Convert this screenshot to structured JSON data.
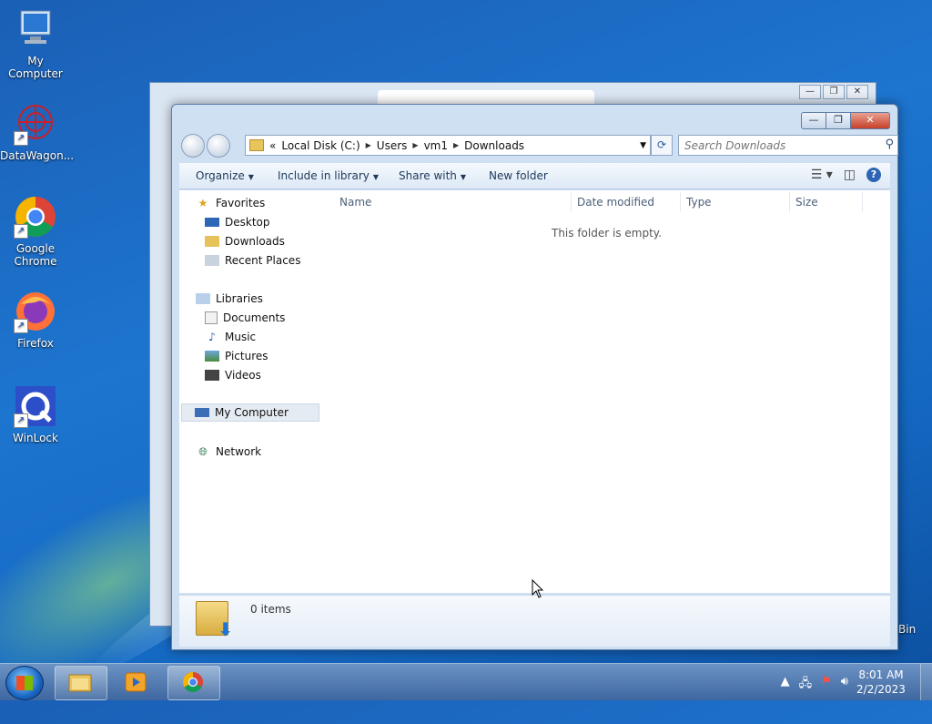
{
  "desktop": {
    "icons": [
      {
        "label": "My Computer"
      },
      {
        "label": "DataWagon..."
      },
      {
        "label": "Google Chrome"
      },
      {
        "label": "Firefox"
      },
      {
        "label": "WinLock"
      }
    ],
    "bin_label": "Bin"
  },
  "explorer": {
    "address": [
      "Local Disk (C:)",
      "Users",
      "vm1",
      "Downloads"
    ],
    "address_prefix": "«",
    "search_placeholder": "Search Downloads",
    "toolbar": {
      "organize": "Organize",
      "include": "Include in library",
      "share": "Share with",
      "new_folder": "New folder"
    },
    "nav": {
      "favorites": "Favorites",
      "desktop": "Desktop",
      "downloads": "Downloads",
      "recent": "Recent Places",
      "libraries": "Libraries",
      "documents": "Documents",
      "music": "Music",
      "pictures": "Pictures",
      "videos": "Videos",
      "computer": "My Computer",
      "network": "Network"
    },
    "columns": [
      "Name",
      "Date modified",
      "Type",
      "Size"
    ],
    "empty_text": "This folder is empty.",
    "item_count": "0 items"
  },
  "taskbar": {
    "time": "8:01 AM",
    "date": "2/2/2023"
  }
}
